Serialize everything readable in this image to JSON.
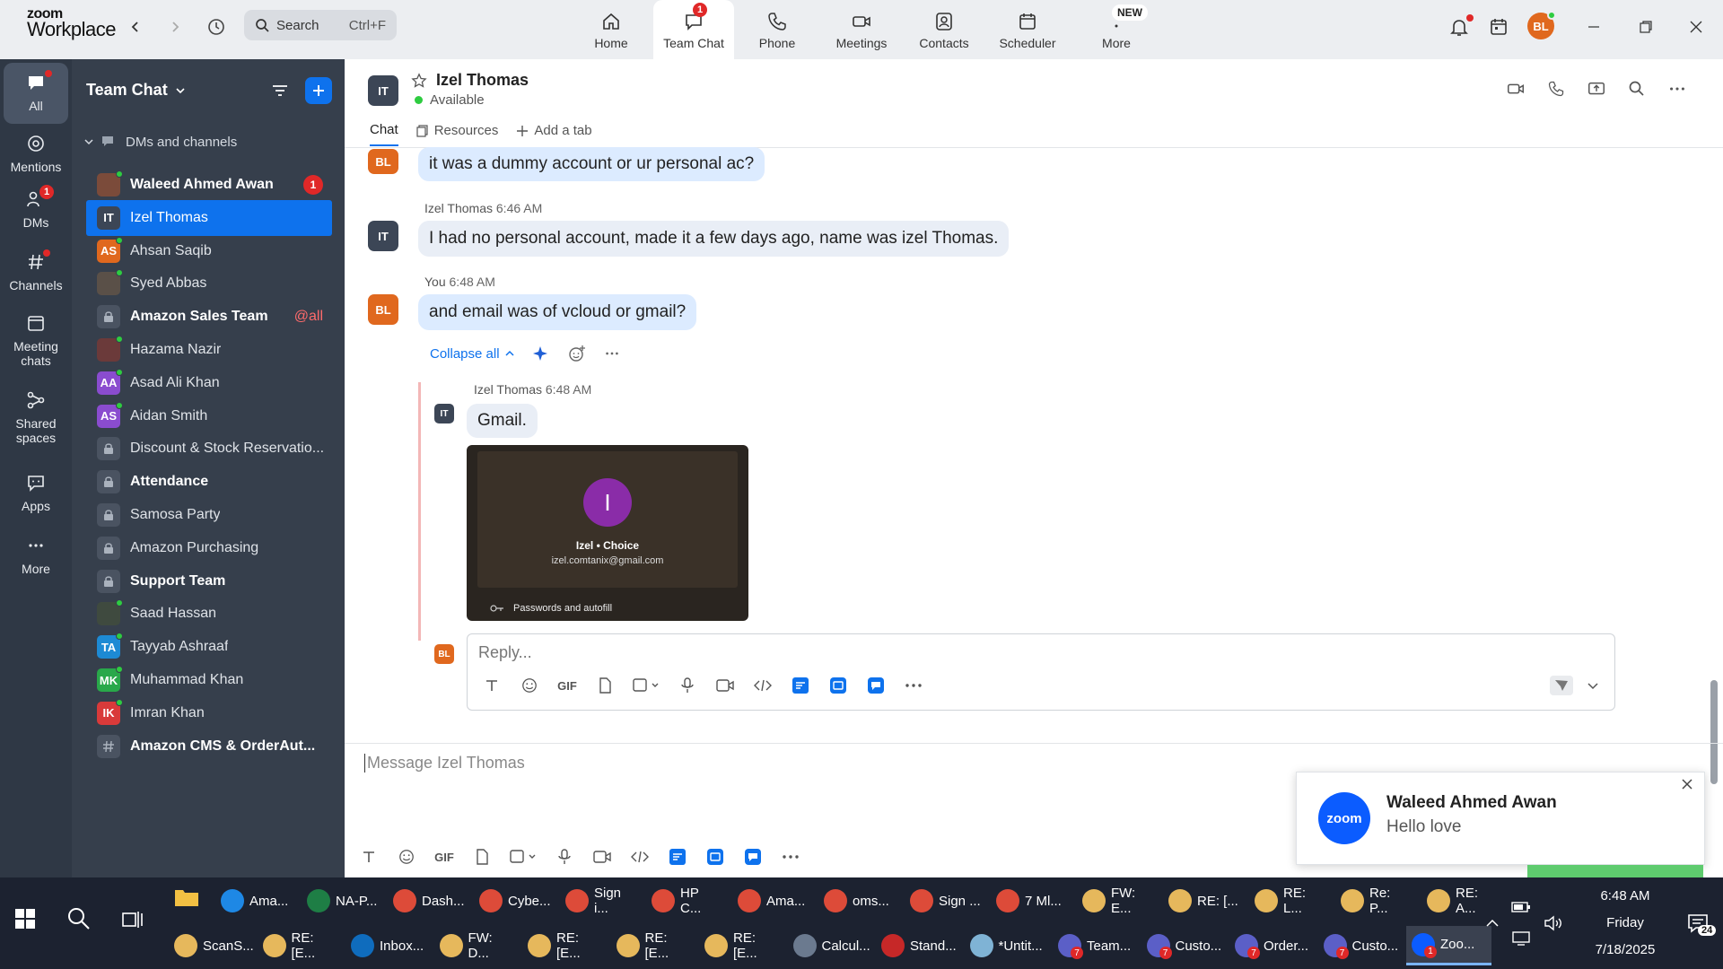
{
  "app": {
    "logo_top": "zoom",
    "logo_bottom": "Workplace",
    "search_placeholder": "Search",
    "search_shortcut": "Ctrl+F",
    "tabs": [
      {
        "label": "Home",
        "icon": "home-icon"
      },
      {
        "label": "Team Chat",
        "icon": "chat-icon",
        "badge": "1",
        "active": true
      },
      {
        "label": "Phone",
        "icon": "phone-icon"
      },
      {
        "label": "Meetings",
        "icon": "video-icon"
      },
      {
        "label": "Contacts",
        "icon": "contacts-icon"
      },
      {
        "label": "Scheduler",
        "icon": "calendar-icon"
      },
      {
        "label": "More",
        "icon": "more-icon",
        "pill": "NEW"
      }
    ],
    "user_initials": "BL",
    "colors": {
      "accent": "#0e72ed",
      "avatar_orange": "#e0681e",
      "alert": "#e02828"
    }
  },
  "rail": [
    {
      "label": "All",
      "icon": "chat-bubble-icon",
      "active": true
    },
    {
      "label": "Mentions",
      "icon": "at-icon"
    },
    {
      "label": "DMs",
      "icon": "people-icon",
      "badge": "1"
    },
    {
      "label": "Channels",
      "icon": "hash-icon"
    },
    {
      "label": "Meeting chats",
      "icon": "calendar-icon"
    },
    {
      "label": "Shared spaces",
      "icon": "share-icon"
    },
    {
      "label": "Apps",
      "icon": "apps-icon"
    },
    {
      "label": "More",
      "icon": "ellipsis-icon"
    }
  ],
  "sidebar": {
    "title": "Team Chat",
    "section": "DMs and channels",
    "items": [
      {
        "name": "Waleed Ahmed Awan",
        "bold": true,
        "count": "1",
        "type": "photo"
      },
      {
        "name": "Izel Thomas",
        "initials": "IT",
        "selected": true,
        "type": "initials"
      },
      {
        "name": "Ahsan Saqib",
        "initials": "AS",
        "type": "initials"
      },
      {
        "name": "Syed Abbas",
        "type": "photo"
      },
      {
        "name": "Amazon Sales Team",
        "bold": true,
        "mention": "@all",
        "type": "lock"
      },
      {
        "name": "Hazama Nazir",
        "type": "photo"
      },
      {
        "name": "Asad Ali Khan",
        "initials": "AA",
        "type": "initials"
      },
      {
        "name": "Aidan Smith",
        "initials": "AS",
        "type": "initials"
      },
      {
        "name": "Discount & Stock Reservatio...",
        "type": "lock"
      },
      {
        "name": "Attendance",
        "bold": true,
        "type": "lock"
      },
      {
        "name": "Samosa Party",
        "type": "lock"
      },
      {
        "name": "Amazon Purchasing",
        "type": "lock"
      },
      {
        "name": "Support Team",
        "bold": true,
        "type": "lock"
      },
      {
        "name": "Saad Hassan",
        "type": "photo"
      },
      {
        "name": "Tayyab Ashraaf",
        "initials": "TA",
        "type": "initials"
      },
      {
        "name": "Muhammad Khan",
        "initials": "MK",
        "type": "initials"
      },
      {
        "name": "Imran Khan",
        "initials": "IK",
        "type": "initials"
      },
      {
        "name": "Amazon CMS & OrderAut...",
        "bold": true,
        "type": "hash"
      }
    ]
  },
  "chat": {
    "contact_initials": "IT",
    "contact_name": "Izel Thomas",
    "status": "Available",
    "tabs": [
      "Chat",
      "Resources",
      "Add a tab"
    ],
    "messages": [
      {
        "initials": "BL",
        "text": "it was a dummy account or ur personal ac?"
      },
      {
        "sender": "Izel Thomas",
        "time": "6:46 AM",
        "initials": "IT",
        "text": "I had no personal account, made it a few days ago, name was izel Thomas."
      },
      {
        "sender": "You",
        "time": "6:48 AM",
        "initials": "BL",
        "text": "and email was of vcloud or gmail?"
      }
    ],
    "thread": {
      "collapse_label": "Collapse all",
      "reply_sender": "Izel Thomas",
      "reply_time": "6:48 AM",
      "reply_initials": "IT",
      "reply_text": "Gmail.",
      "attachment": {
        "letter": "I",
        "title": "Izel • Choice",
        "email": "izel.comtanix@gmail.com",
        "footer": "Passwords and autofill"
      },
      "reply_placeholder": "Reply...",
      "reply_initials_self": "BL"
    },
    "compose_placeholder": "Message Izel Thomas",
    "toolbar_gif": "GIF"
  },
  "notification": {
    "logo": "zoom",
    "title": "Waleed Ahmed Awan",
    "message": "Hello love"
  },
  "taskbar": {
    "row1": [
      {
        "label": "Ama...",
        "color": "#1e88e5"
      },
      {
        "label": "NA-P...",
        "color": "#1e7e45"
      },
      {
        "label": "Dash...",
        "color": "#dd4b39"
      },
      {
        "label": "Cybe...",
        "color": "#dd4b39"
      },
      {
        "label": "Sign i...",
        "color": "#dd4b39"
      },
      {
        "label": "HP C...",
        "color": "#dd4b39"
      },
      {
        "label": "Ama...",
        "color": "#dd4b39"
      },
      {
        "label": "oms...",
        "color": "#dd4b39"
      },
      {
        "label": "Sign ...",
        "color": "#dd4b39"
      },
      {
        "label": "7 Ml...",
        "color": "#dd4b39"
      },
      {
        "label": "FW: E...",
        "color": "#e6b85c"
      },
      {
        "label": "RE: [...",
        "color": "#e6b85c"
      },
      {
        "label": "RE: L...",
        "color": "#e6b85c"
      },
      {
        "label": "Re: P...",
        "color": "#e6b85c"
      },
      {
        "label": "RE: A...",
        "color": "#e6b85c"
      }
    ],
    "row2": [
      {
        "label": "ScanS...",
        "color": "#e6b85c"
      },
      {
        "label": "RE: [E...",
        "color": "#e6b85c"
      },
      {
        "label": "Inbox...",
        "color": "#0f6cbd"
      },
      {
        "label": "FW: D...",
        "color": "#e6b85c"
      },
      {
        "label": "RE: [E...",
        "color": "#e6b85c"
      },
      {
        "label": "RE: [E...",
        "color": "#e6b85c"
      },
      {
        "label": "RE: [E...",
        "color": "#e6b85c"
      },
      {
        "label": "Calcul...",
        "color": "#6b7a8f"
      },
      {
        "label": "Stand...",
        "color": "#c62828"
      },
      {
        "label": "*Untit...",
        "color": "#7fb3d5"
      },
      {
        "label": "Team...",
        "color": "#5b5fc7",
        "badge": "7"
      },
      {
        "label": "Custo...",
        "color": "#5b5fc7",
        "badge": "7"
      },
      {
        "label": "Order...",
        "color": "#5b5fc7",
        "badge": "7"
      },
      {
        "label": "Custo...",
        "color": "#5b5fc7",
        "badge": "7"
      },
      {
        "label": "Zoo...",
        "color": "#0b5cff",
        "badge": "1",
        "active": true
      }
    ],
    "time": "6:48 AM",
    "day": "Friday",
    "date": "7/18/2025",
    "notif_count": "24"
  }
}
